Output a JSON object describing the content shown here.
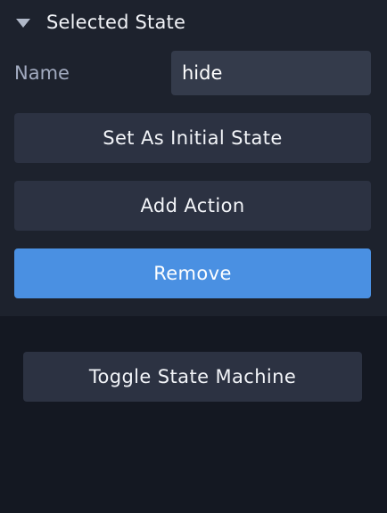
{
  "section": {
    "title": "Selected State",
    "expand_icon": "caret-down-icon"
  },
  "name_field": {
    "label": "Name",
    "value": "hide"
  },
  "buttons": {
    "set_initial": "Set As Initial State",
    "add_action": "Add Action",
    "remove": "Remove",
    "toggle_state_machine": "Toggle State Machine"
  },
  "colors": {
    "background": "#141822",
    "panel": "#1d222d",
    "button": "#2c3242",
    "input": "#343b4b",
    "accent": "#4a90e2"
  }
}
